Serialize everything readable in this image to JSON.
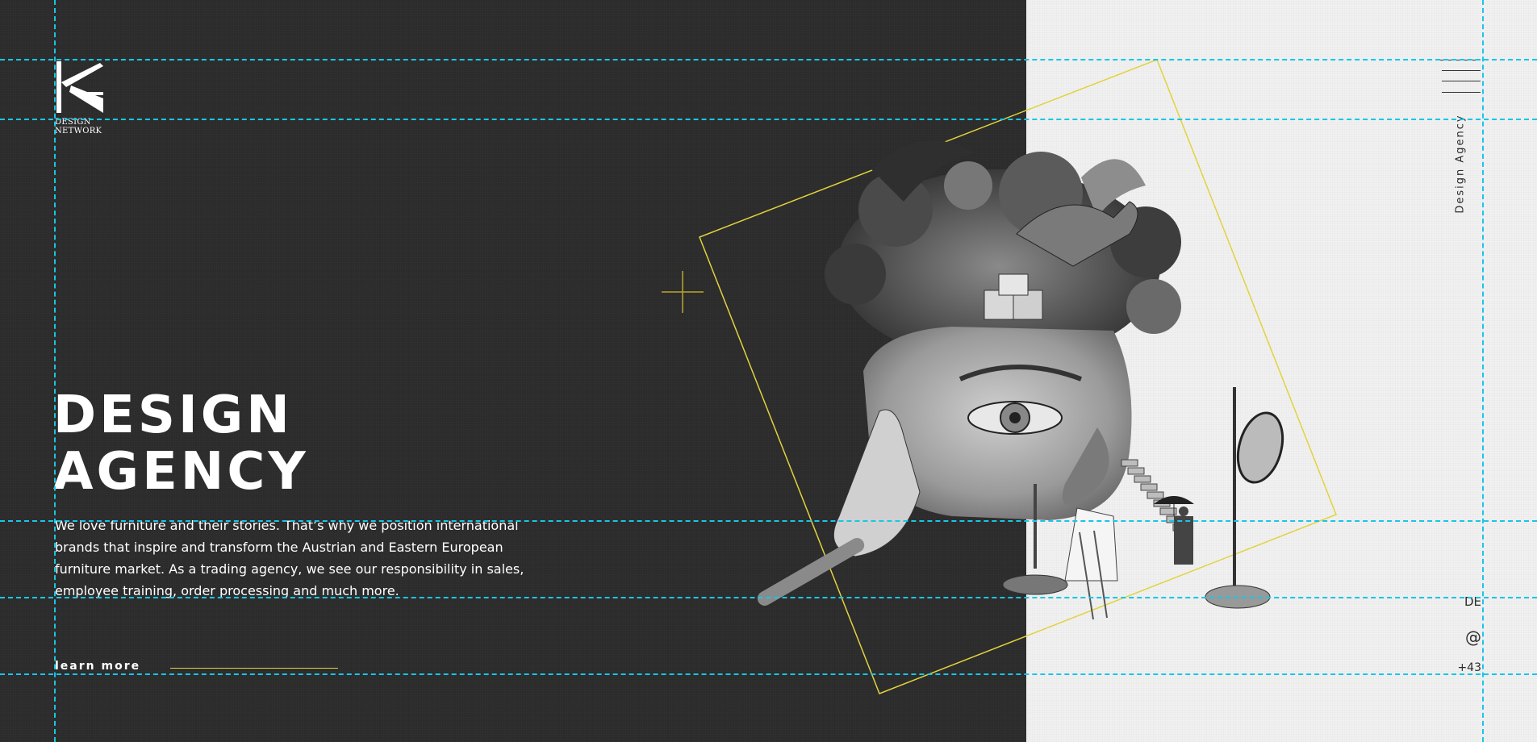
{
  "brand": {
    "logo_letter": "K",
    "logo_line1": "DESIGN",
    "logo_line2": "NETWORK"
  },
  "hero": {
    "title_line1": "DESIGN",
    "title_line2": "AGENCY",
    "description": "We love furniture and their stories. That’s why we position international brands that inspire and transform the Austrian and Eastern European furniture market. As a trading agency, we see our responsibility in sales, employee training, order processing and much more.",
    "cta_label": "learn more"
  },
  "sidebar": {
    "vertical_label": "Design Agency",
    "language": "DE",
    "email_symbol": "@",
    "phone": "+43"
  },
  "icons": {
    "menu": "hamburger-menu-icon",
    "plus": "plus-cross-icon"
  },
  "colors": {
    "dark_bg": "#2b2b2b",
    "light_bg": "#f1f1f1",
    "accent_yellow": "#e1d33d",
    "guide_cyan": "#18c6e8",
    "text_light": "#ffffff",
    "text_dark": "#2b2b2b"
  }
}
